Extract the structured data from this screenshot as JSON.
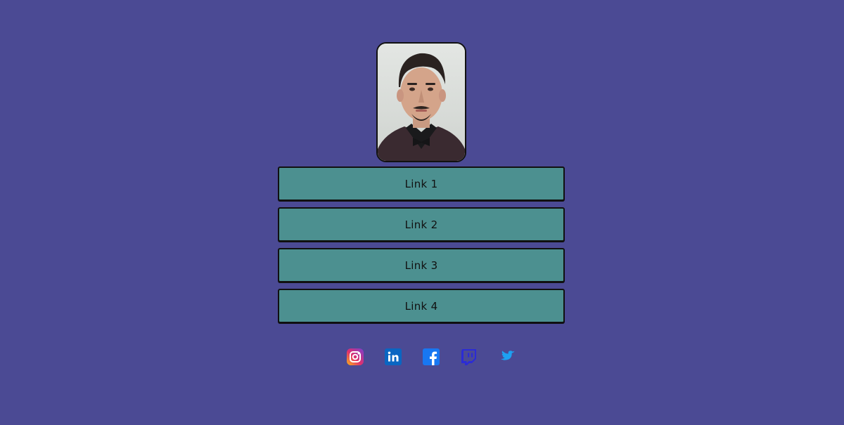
{
  "profile": {
    "avatar_alt": "profile photo"
  },
  "links": [
    {
      "label": "Link 1"
    },
    {
      "label": "Link 2"
    },
    {
      "label": "Link 3"
    },
    {
      "label": "Link 4"
    }
  ],
  "socials": [
    {
      "icon": "instagram-icon",
      "color": "#e1306c"
    },
    {
      "icon": "linkedin-icon",
      "color": "#0a66c2"
    },
    {
      "icon": "facebook-icon",
      "color": "#1877f2"
    },
    {
      "icon": "twitch-icon",
      "color": "#2b2bd6"
    },
    {
      "icon": "twitter-icon",
      "color": "#1da1f2"
    }
  ],
  "colors": {
    "background": "#4b4a94",
    "button": "#4c9090",
    "border": "#101010"
  }
}
